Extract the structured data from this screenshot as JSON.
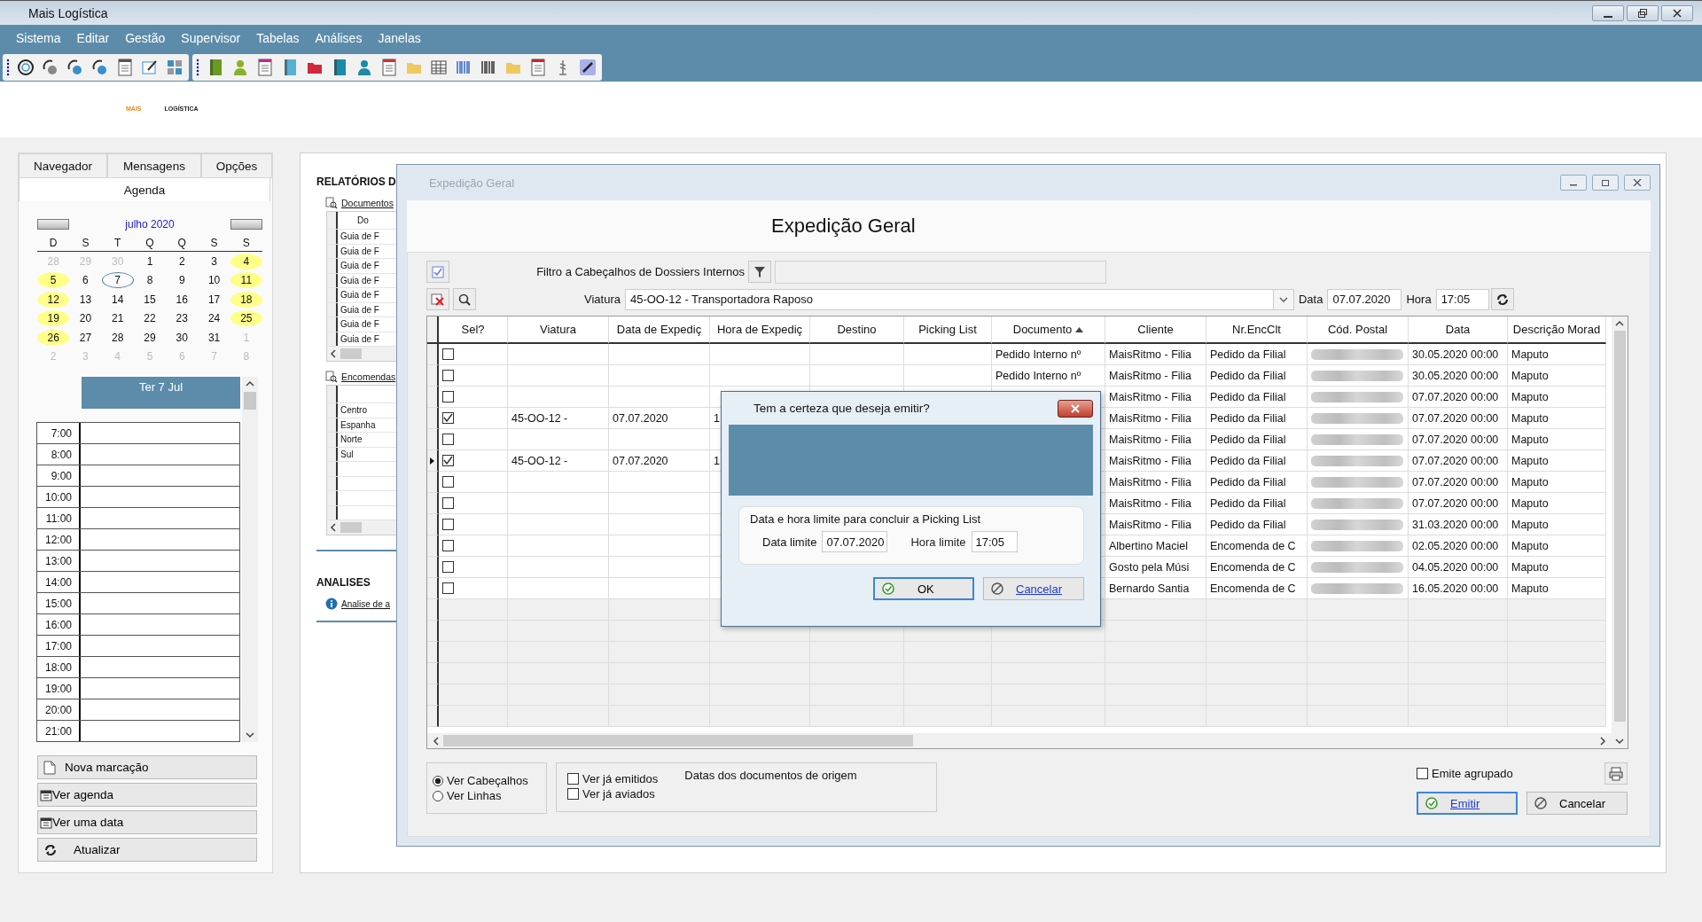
{
  "app": {
    "title": "Mais Logística",
    "menus": [
      "Sistema",
      "Editar",
      "Gestão",
      "Supervisor",
      "Tabelas",
      "Análises",
      "Janelas"
    ],
    "logo": {
      "part_1": "MAIS",
      "part_2": "LOGÍSTICA"
    }
  },
  "left_panel": {
    "tabs": [
      {
        "label": "Navegador",
        "selected": false
      },
      {
        "label": "Mensagens",
        "selected": false
      },
      {
        "label": "Opções",
        "selected": false
      },
      {
        "label": "Agenda",
        "selected": true
      }
    ],
    "calendar": {
      "month": "julho 2020",
      "weekdays": [
        "D",
        "S",
        "T",
        "Q",
        "Q",
        "S",
        "S"
      ],
      "days": [
        {
          "day": "28",
          "other_month": true,
          "highlighted": false,
          "today": false
        },
        {
          "day": "29",
          "other_month": true,
          "highlighted": false,
          "today": false
        },
        {
          "day": "30",
          "other_month": true,
          "highlighted": false,
          "today": false
        },
        {
          "day": "1",
          "other_month": false,
          "highlighted": false,
          "today": false
        },
        {
          "day": "2",
          "other_month": false,
          "highlighted": false,
          "today": false
        },
        {
          "day": "3",
          "other_month": false,
          "highlighted": false,
          "today": false
        },
        {
          "day": "4",
          "other_month": false,
          "highlighted": true,
          "today": false
        },
        {
          "day": "5",
          "other_month": false,
          "highlighted": true,
          "today": false
        },
        {
          "day": "6",
          "other_month": false,
          "highlighted": false,
          "today": false
        },
        {
          "day": "7",
          "other_month": false,
          "highlighted": false,
          "today": true
        },
        {
          "day": "8",
          "other_month": false,
          "highlighted": false,
          "today": false
        },
        {
          "day": "9",
          "other_month": false,
          "highlighted": false,
          "today": false
        },
        {
          "day": "10",
          "other_month": false,
          "highlighted": false,
          "today": false
        },
        {
          "day": "11",
          "other_month": false,
          "highlighted": true,
          "today": false
        },
        {
          "day": "12",
          "other_month": false,
          "highlighted": true,
          "today": false
        },
        {
          "day": "13",
          "other_month": false,
          "highlighted": false,
          "today": false
        },
        {
          "day": "14",
          "other_month": false,
          "highlighted": false,
          "today": false
        },
        {
          "day": "15",
          "other_month": false,
          "highlighted": false,
          "today": false
        },
        {
          "day": "16",
          "other_month": false,
          "highlighted": false,
          "today": false
        },
        {
          "day": "17",
          "other_month": false,
          "highlighted": false,
          "today": false
        },
        {
          "day": "18",
          "other_month": false,
          "highlighted": true,
          "today": false
        },
        {
          "day": "19",
          "other_month": false,
          "highlighted": true,
          "today": false
        },
        {
          "day": "20",
          "other_month": false,
          "highlighted": false,
          "today": false
        },
        {
          "day": "21",
          "other_month": false,
          "highlighted": false,
          "today": false
        },
        {
          "day": "22",
          "other_month": false,
          "highlighted": false,
          "today": false
        },
        {
          "day": "23",
          "other_month": false,
          "highlighted": false,
          "today": false
        },
        {
          "day": "24",
          "other_month": false,
          "highlighted": false,
          "today": false
        },
        {
          "day": "25",
          "other_month": false,
          "highlighted": true,
          "today": false
        },
        {
          "day": "26",
          "other_month": false,
          "highlighted": true,
          "today": false
        },
        {
          "day": "27",
          "other_month": false,
          "highlighted": false,
          "today": false
        },
        {
          "day": "28",
          "other_month": false,
          "highlighted": false,
          "today": false
        },
        {
          "day": "29",
          "other_month": false,
          "highlighted": false,
          "today": false
        },
        {
          "day": "30",
          "other_month": false,
          "highlighted": false,
          "today": false
        },
        {
          "day": "31",
          "other_month": false,
          "highlighted": false,
          "today": false
        },
        {
          "day": "1",
          "other_month": true,
          "highlighted": false,
          "today": false
        },
        {
          "day": "2",
          "other_month": true,
          "highlighted": false,
          "today": false
        },
        {
          "day": "3",
          "other_month": true,
          "highlighted": false,
          "today": false
        },
        {
          "day": "4",
          "other_month": true,
          "highlighted": false,
          "today": false
        },
        {
          "day": "5",
          "other_month": true,
          "highlighted": false,
          "today": false
        },
        {
          "day": "6",
          "other_month": true,
          "highlighted": false,
          "today": false
        },
        {
          "day": "7",
          "other_month": true,
          "highlighted": false,
          "today": false
        },
        {
          "day": "8",
          "other_month": true,
          "highlighted": false,
          "today": false
        }
      ]
    },
    "day_view": {
      "title": "Ter 7 Jul",
      "hours": [
        "7:00",
        "8:00",
        "9:00",
        "10:00",
        "11:00",
        "12:00",
        "13:00",
        "14:00",
        "15:00",
        "16:00",
        "17:00",
        "18:00",
        "19:00",
        "20:00",
        "21:00"
      ]
    },
    "buttons": [
      "Nova marcação",
      "Ver agenda",
      "Ver uma data",
      "Atualizar"
    ]
  },
  "reports_panel": {
    "title": "RELATÓRIOS D",
    "documents_link": "Documentos",
    "documents_header": "Do",
    "documents_rows": [
      "Guia de F",
      "Guia de F",
      "Guia de F",
      "Guia de F",
      "Guia de F",
      "Guia de F",
      "Guia de F",
      "Guia de F"
    ],
    "orders_link": "Encomendas",
    "orders_rows": [
      "Centro",
      "Espanha",
      "Norte",
      "Sul"
    ],
    "analyses_title": "ANALISES",
    "analyses_link": "Analise de a"
  },
  "window": {
    "title": "Expedição Geral",
    "heading": "Expedição Geral",
    "filter_label": "Filtro a Cabeçalhos de Dossiers Internos",
    "vehicle_label": "Viatura",
    "vehicle_value": "45-OO-12 - Transportadora Raposo",
    "date_label": "Data",
    "date_value": "07.07.2020",
    "time_label": "Hora",
    "time_value": "17:05",
    "grid": {
      "columns": [
        {
          "label": "Sel?",
          "sorted": false
        },
        {
          "label": "Viatura",
          "sorted": false
        },
        {
          "label": "Data de Expediç",
          "sorted": false
        },
        {
          "label": "Hora de Expediç",
          "sorted": false
        },
        {
          "label": "Destino",
          "sorted": false
        },
        {
          "label": "Picking List",
          "sorted": false
        },
        {
          "label": "Documento",
          "sorted": true
        },
        {
          "label": "Cliente",
          "sorted": false
        },
        {
          "label": "Nr.EncClt",
          "sorted": false
        },
        {
          "label": "Cód. Postal",
          "sorted": false
        },
        {
          "label": "Data",
          "sorted": false
        },
        {
          "label": "Descrição Morad",
          "sorted": false
        }
      ],
      "rows": [
        {
          "current": false,
          "checked": false,
          "documento": "Pedido Interno nº",
          "cliente": "MaisRitmo - Filia",
          "nr_enc_clt": "Pedido da Filial",
          "data": "30.05.2020 00:00",
          "morada": "Maputo"
        },
        {
          "current": false,
          "checked": false,
          "documento": "Pedido Interno nº",
          "cliente": "MaisRitmo - Filia",
          "nr_enc_clt": "Pedido da Filial",
          "data": "30.05.2020 00:00",
          "morada": "Maputo"
        },
        {
          "current": false,
          "checked": false,
          "cliente": "MaisRitmo - Filia",
          "nr_enc_clt": "Pedido da Filial",
          "data": "07.07.2020 00:00",
          "morada": "Maputo"
        },
        {
          "current": false,
          "checked": true,
          "viatura": "45-OO-12 -",
          "data_expedicao": "07.07.2020",
          "hora_expedicao": "1",
          "cliente": "MaisRitmo - Filia",
          "nr_enc_clt": "Pedido da Filial",
          "data": "07.07.2020 00:00",
          "morada": "Maputo"
        },
        {
          "current": false,
          "checked": false,
          "cliente": "MaisRitmo - Filia",
          "nr_enc_clt": "Pedido da Filial",
          "data": "07.07.2020 00:00",
          "morada": "Maputo"
        },
        {
          "current": true,
          "checked": true,
          "viatura": "45-OO-12 -",
          "data_expedicao": "07.07.2020",
          "hora_expedicao": "1",
          "cliente": "MaisRitmo - Filia",
          "nr_enc_clt": "Pedido da Filial",
          "data": "07.07.2020 00:00",
          "morada": "Maputo"
        },
        {
          "current": false,
          "checked": false,
          "cliente": "MaisRitmo - Filia",
          "nr_enc_clt": "Pedido da Filial",
          "data": "07.07.2020 00:00",
          "morada": "Maputo"
        },
        {
          "current": false,
          "checked": false,
          "cliente": "MaisRitmo - Filia",
          "nr_enc_clt": "Pedido da Filial",
          "data": "07.07.2020 00:00",
          "morada": "Maputo"
        },
        {
          "current": false,
          "checked": false,
          "cliente": "MaisRitmo - Filia",
          "nr_enc_clt": "Pedido da Filial",
          "data": "31.03.2020 00:00",
          "morada": "Maputo"
        },
        {
          "current": false,
          "checked": false,
          "cliente": "Albertino Maciel",
          "nr_enc_clt": "Encomenda de C",
          "data": "02.05.2020 00:00",
          "morada": "Maputo"
        },
        {
          "current": false,
          "checked": false,
          "cliente": "Gosto pela Músi",
          "nr_enc_clt": "Encomenda de C",
          "data": "04.05.2020 00:00",
          "morada": "Maputo"
        },
        {
          "current": false,
          "checked": false,
          "cliente": "Bernardo Santia",
          "nr_enc_clt": "Encomenda de C",
          "data": "16.05.2020 00:00",
          "morada": "Maputo"
        }
      ]
    },
    "view_options": [
      {
        "label": "Ver Cabeçalhos",
        "selected": true
      },
      {
        "label": "Ver Linhas",
        "selected": false
      }
    ],
    "origin_dates_title": "Datas dos documentos de origem",
    "origin_options": [
      {
        "label": "Ver já emitidos",
        "checked": false
      },
      {
        "label": "Ver já aviados",
        "checked": false
      }
    ],
    "group_emit": {
      "label": "Emite agrupado",
      "checked": false
    },
    "buttons": [
      "Emitir",
      "Cancelar"
    ]
  },
  "dialog": {
    "title": "Tem a certeza que deseja emitir?",
    "group_label": "Data e hora limite para concluir a Picking List",
    "date_label": "Data limite",
    "date_value": "07.07.2020",
    "time_label": "Hora limite",
    "time_value": "17:05",
    "buttons": [
      "OK",
      "Cancelar"
    ]
  }
}
